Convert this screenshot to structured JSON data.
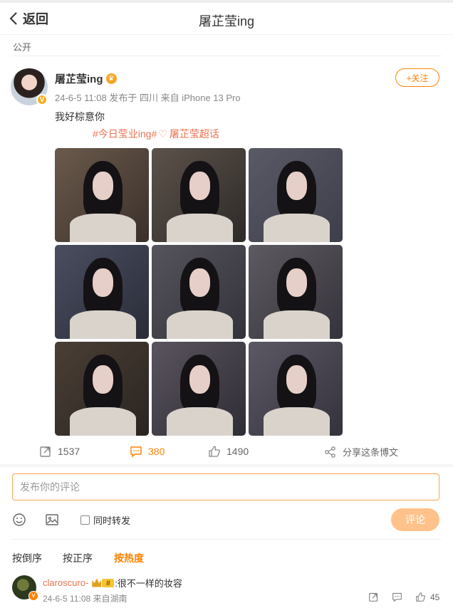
{
  "header": {
    "back_label": "返回",
    "title": "屠芷莹ing"
  },
  "visibility": "公开",
  "post": {
    "author": "屠芷莹ing",
    "meta": "24-6-5 11:08  发布于 四川  来自 iPhone 13 Pro",
    "follow_label": "+关注",
    "text": "我好棕意你",
    "tag1": "#今日莹业ing#",
    "tag2": "屠芷莹超话",
    "photo_count": 9
  },
  "actions": {
    "repost_count": "1537",
    "comment_count": "380",
    "like_count": "1490",
    "share_label": "分享这条博文"
  },
  "composer": {
    "placeholder": "发布你的评论",
    "repost_label": "同时转发",
    "submit_label": "评论"
  },
  "sort": {
    "by_reverse": "按倒序",
    "by_order": "按正序",
    "by_hot": "按热度"
  },
  "comment": {
    "user": "claroscuro-",
    "level": "II",
    "text": ":很不一样的妆容",
    "meta": "24-6-5 11:08  来自湖南",
    "like_count": "45"
  },
  "colors": {
    "accent": "#ff8200",
    "tag": "#eb7350",
    "submit_bg": "#ffc28a"
  }
}
